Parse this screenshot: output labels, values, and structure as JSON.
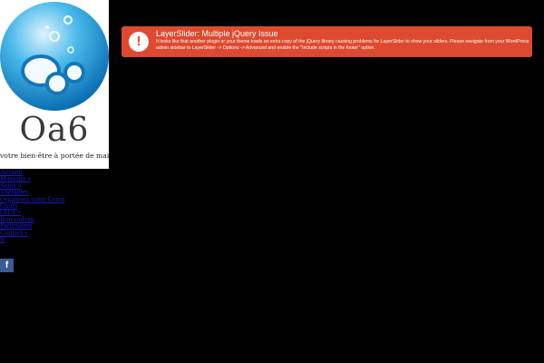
{
  "brand": {
    "name": "Oa6",
    "tagline": "votre bien-être à portée de main"
  },
  "nav": {
    "items": [
      {
        "label": "Accueil"
      },
      {
        "label": "Massage »"
      },
      {
        "label": "Soins »"
      },
      {
        "label": "Thérapies"
      },
      {
        "label": "Organisez votre Event"
      },
      {
        "label": "Cours"
      },
      {
        "label": "Offre »"
      },
      {
        "label": "Bon cadeau"
      },
      {
        "label": "Partenaires"
      },
      {
        "label": "Contact »"
      },
      {
        "label": "fr"
      }
    ]
  },
  "social": {
    "facebook_label": "f"
  },
  "alert": {
    "icon": "!",
    "title": "LayerSlider: Multiple jQuery Issue",
    "message": "It looks like that another plugin or your theme loads an extra copy of the jQuery library causing problems for LayerSlider to show your sliders. Please navigate from your WordPress admin sidebar to LayerSlider -> Options -> Advanced and enable the \"Include scripts in the footer\" option."
  },
  "colors": {
    "background": "#000000",
    "alert": "#de4a2f",
    "link": "#1b1bd0",
    "facebook": "#3b5998"
  }
}
